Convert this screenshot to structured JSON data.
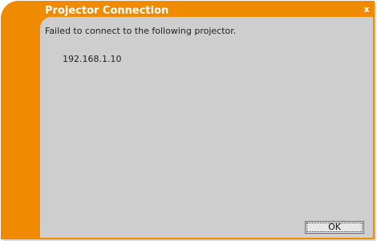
{
  "dialog": {
    "title": "Projector Connection",
    "close_icon": "close-icon",
    "close_glyph": "x",
    "message": "Failed to connect to the following projector.",
    "ip_address": "192.168.1.10",
    "ok_label": "OK"
  },
  "colors": {
    "accent": "#f08a00",
    "content_bg": "#cecece"
  }
}
